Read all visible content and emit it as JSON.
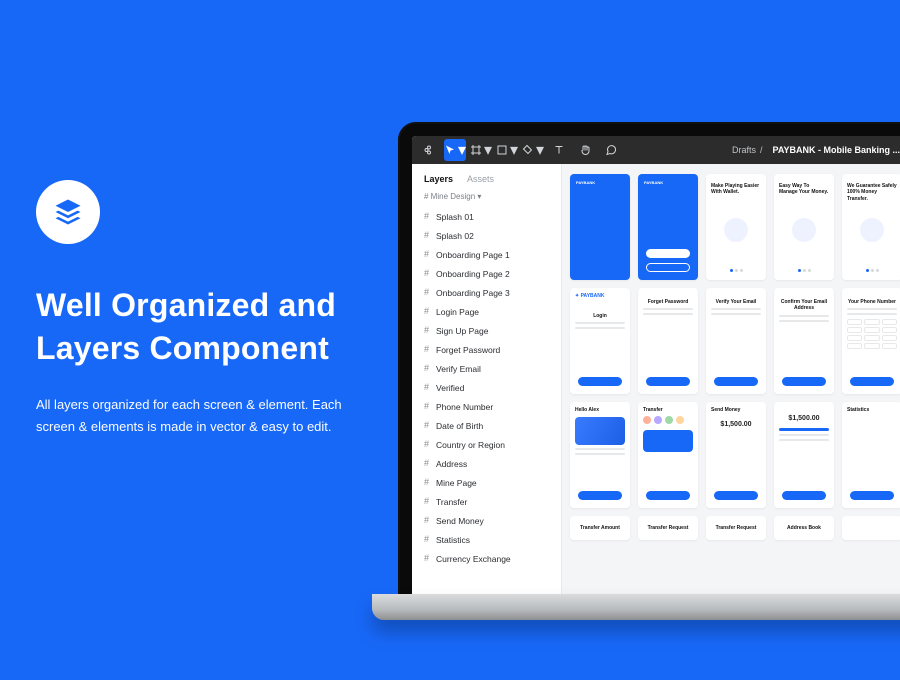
{
  "promo": {
    "headline": "Well Organized and Layers Component",
    "sub": "All layers organized for each screen & element. Each screen & elements is made in vector & easy to edit."
  },
  "topbar": {
    "breadcrumb_root": "Drafts",
    "breadcrumb_sep": "/",
    "file_name": "PAYBANK - Mobile Banking ..."
  },
  "sidebar": {
    "tabs": {
      "layers": "Layers",
      "assets": "Assets"
    },
    "page": "# Mine Design",
    "items": [
      "Splash 01",
      "Splash 02",
      "Onboarding Page 1",
      "Onboarding Page 2",
      "Onboarding Page 3",
      "Login Page",
      "Sign Up Page",
      "Forget Password",
      "Verify Email",
      "Verified",
      "Phone Number",
      "Date of Birth",
      "Country or Region",
      "Address",
      "Mine Page",
      "Transfer",
      "Send Money",
      "Statistics",
      "Currency Exchange"
    ]
  },
  "cards": {
    "logo": "PAYBANK",
    "r1": [
      {
        "type": "splash"
      },
      {
        "type": "splash2"
      },
      {
        "title": "Make Playing Easier With Wallet."
      },
      {
        "title": "Easy Way To Manage Your Money."
      },
      {
        "title": "We Guarantee Safely 100% Money Transfer."
      }
    ],
    "r2": [
      {
        "title": "Login",
        "logo": true
      },
      {
        "title": "Forget Password"
      },
      {
        "title": "Verify Your Email"
      },
      {
        "title": "Confirm Your Email Address"
      },
      {
        "title": "Your Phone Number",
        "keypad": true
      }
    ],
    "r3": [
      {
        "title": "Hello Alex",
        "wallet": true
      },
      {
        "title": "Transfer",
        "avatars": true
      },
      {
        "title": "Send Money",
        "amount": "$1,500.00"
      },
      {
        "title": "",
        "amount": "$1,500.00",
        "sliders": true
      },
      {
        "title": "Statistics"
      }
    ],
    "r4": [
      {
        "title": "Transfer Amount"
      },
      {
        "title": "Transfer Request"
      },
      {
        "title": "Transfer Request"
      },
      {
        "title": "Address Book"
      },
      {
        "title": ""
      }
    ]
  }
}
